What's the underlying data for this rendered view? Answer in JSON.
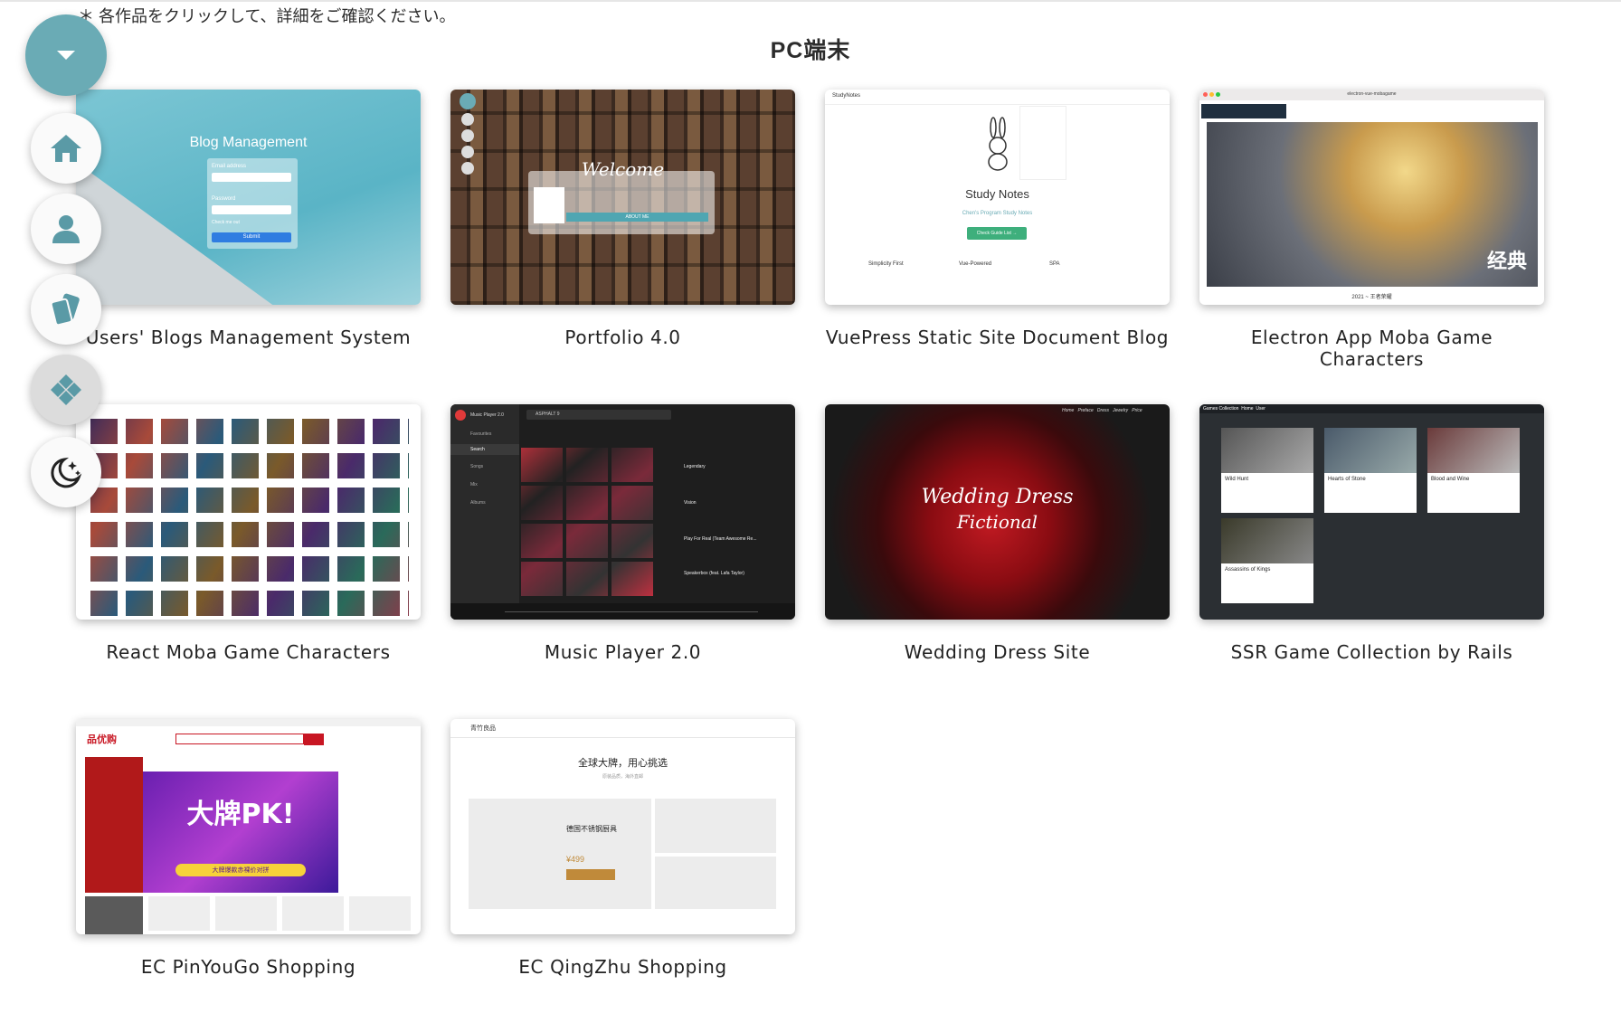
{
  "notice": "＊ 各作品をクリックして、詳細をご確認ください。",
  "section_title": "PC端末",
  "sidebar": {
    "toggle_icon": "caret-down-icon",
    "items": [
      {
        "icon": "home-icon"
      },
      {
        "icon": "user-icon"
      },
      {
        "icon": "cards-icon"
      },
      {
        "icon": "diamonds-icon"
      },
      {
        "icon": "moon-stars-icon"
      }
    ]
  },
  "projects": [
    {
      "title": "Users' Blogs Management System",
      "thumb": {
        "heading": "Blog Management",
        "email_label": "Email address",
        "password_label": "Password",
        "check_label": "Check me out",
        "submit": "Submit"
      }
    },
    {
      "title": "Portfolio 4.0",
      "thumb": {
        "heading": "Welcome",
        "button": "ABOUT ME"
      }
    },
    {
      "title": "VuePress Static Site Document Blog",
      "thumb": {
        "brand": "StudyNotes",
        "heading": "Study Notes",
        "subtitle": "Chen's Program Study Notes",
        "button": "Check Guide List →",
        "features": [
          "Simplicity First",
          "Vue-Powered",
          "SPA"
        ]
      }
    },
    {
      "title": "Electron App Moba Game Characters",
      "thumb": {
        "window_title": "electron-vue-mobagame",
        "badge": "经典",
        "caption": "2021 ~ 王者荣耀"
      }
    },
    {
      "title": "React Moba Game Characters",
      "thumb": {}
    },
    {
      "title": "Music Player 2.0",
      "thumb": {
        "app": "Music Player 2.0",
        "search": "ASPHALT 9",
        "nav": [
          "Favourites",
          "Search",
          "Songs",
          "Mix",
          "Albums"
        ],
        "tracks": [
          "Legendary",
          "Vision",
          "Play For Real (Team Awesome Re...",
          "Speakerbox (feat. Lafa Taylor)"
        ]
      }
    },
    {
      "title": "Wedding Dress Site",
      "thumb": {
        "line1": "Wedding Dress",
        "line2": "Fictional",
        "nav": [
          "Home",
          "Preface",
          "Dress",
          "Jewelry",
          "Price"
        ]
      }
    },
    {
      "title": "SSR Game Collection by Rails",
      "thumb": {
        "brand": "Games Collection",
        "nav": [
          "Home",
          "User"
        ],
        "games": [
          "Wild Hunt",
          "Hearts of Stone",
          "Blood and Wine",
          "Assassins of Kings"
        ]
      }
    },
    {
      "title": "EC PinYouGo Shopping",
      "thumb": {
        "logo": "品优购",
        "banner": "大牌PK!",
        "sub": "大牌爆款赤裸价对拼"
      }
    },
    {
      "title": "EC QingZhu Shopping",
      "thumb": {
        "logo": "青竹良品",
        "heading": "全球大牌，用心挑选",
        "sub": "原装品质，海外直邮",
        "product": "德国不锈钢厨具",
        "price": "¥499"
      }
    }
  ],
  "colors": {
    "accent": "#6aabb5",
    "pinyougo_red": "#c81623",
    "submit_blue": "#2f7de1"
  }
}
